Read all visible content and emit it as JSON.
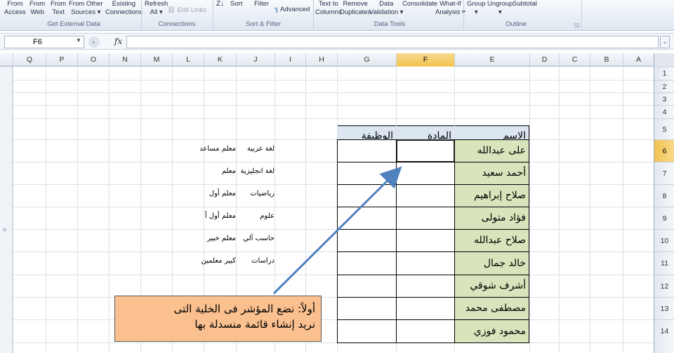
{
  "ribbon": {
    "buttons": [
      {
        "id": "from-access",
        "label": "From\nAccess"
      },
      {
        "id": "from-web",
        "label": "From\nWeb"
      },
      {
        "id": "from-text",
        "label": "From\nText"
      },
      {
        "id": "from-other",
        "label": "From Other\nSources ▾"
      },
      {
        "id": "existing-connections",
        "label": "Existing\nConnections"
      },
      {
        "id": "refresh-all",
        "label": "Refresh\nAll ▾"
      },
      {
        "id": "edit-links",
        "label": "Edit Links"
      },
      {
        "id": "sort",
        "label": "Sort"
      },
      {
        "id": "filter",
        "label": "Filter"
      },
      {
        "id": "advanced",
        "label": "Advanced"
      },
      {
        "id": "text-to-columns",
        "label": "Text to\nColumns"
      },
      {
        "id": "remove-duplicates",
        "label": "Remove\nDuplicates"
      },
      {
        "id": "data-validation",
        "label": "Data\nValidation ▾"
      },
      {
        "id": "consolidate",
        "label": "Consolidate"
      },
      {
        "id": "what-if",
        "label": "What-If\nAnalysis ▾"
      },
      {
        "id": "group",
        "label": "Group\n▾"
      },
      {
        "id": "ungroup",
        "label": "Ungroup\n▾"
      },
      {
        "id": "subtotal",
        "label": "Subtotal"
      }
    ],
    "groups": {
      "get_external_data": "Get External Data",
      "connections": "Connections",
      "sort_filter": "Sort & Filter",
      "data_tools": "Data Tools",
      "outline": "Outline"
    }
  },
  "formula_bar": {
    "name_box": "F6",
    "fx_label": "fx",
    "formula": ""
  },
  "columns": [
    "Q",
    "P",
    "O",
    "N",
    "M",
    "L",
    "K",
    "J",
    "I",
    "H",
    "G",
    "F",
    "E",
    "D",
    "C",
    "B",
    "A"
  ],
  "rows": [
    "1",
    "2",
    "3",
    "4",
    "5",
    "6",
    "7",
    "8",
    "9",
    "10",
    "11",
    "12",
    "13",
    "14"
  ],
  "active_cell": {
    "col": "F",
    "row": "6"
  },
  "table": {
    "headers": {
      "name": "الاسم",
      "subject": "المادة",
      "job": "الوظيفة"
    },
    "names": [
      "على عبدالله",
      "أحمد سعيد",
      "صلاح إبراهيم",
      "فؤاد متولى",
      "صلاح عبدالله",
      "خالد جمال",
      "أشرف شوقي",
      "مصطفى محمد",
      "محمود فوزي"
    ]
  },
  "side_lists": {
    "subjects": [
      "لغة عربية",
      "لغة انجليزية",
      "رياضيات",
      "علوم",
      "حاسب آلي",
      "دراسات"
    ],
    "jobs": [
      "معلم مساعد",
      "معلم",
      "معلم أول",
      "معلم أول أ",
      "معلم خبير",
      "كبير معلمين"
    ]
  },
  "callout": {
    "line1": "أولاً: نضع المؤشر فى الخلية التى",
    "line2": "نريد إنشاء قائمة منسدلة بها"
  },
  "colors": {
    "header_fill": "#dce6f1",
    "name_fill": "#d7e4bc",
    "callout_fill": "#fac08f",
    "arrow": "#4f81bd",
    "active_header": "#f6cf6e"
  }
}
